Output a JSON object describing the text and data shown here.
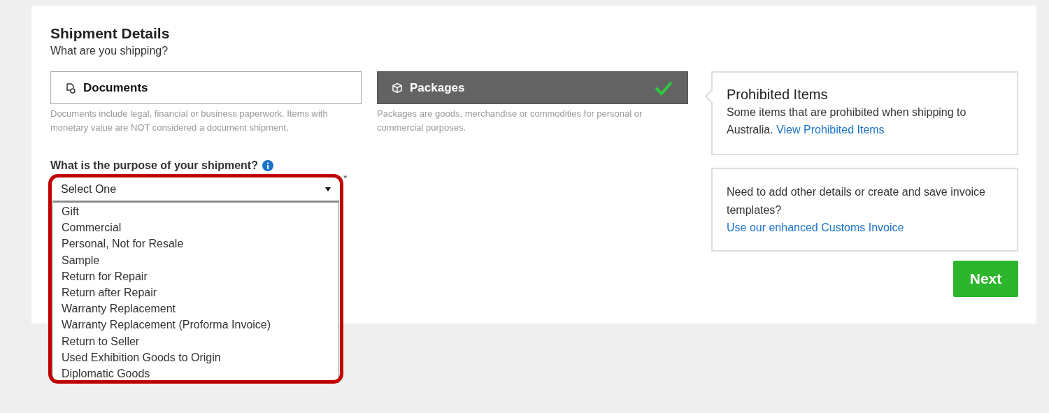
{
  "title": "Shipment Details",
  "subtitle": "What are you shipping?",
  "types": [
    {
      "kind": "documents",
      "label": "Documents",
      "description": "Documents include legal, financial or business paperwork. Items with monetary value are NOT considered a document shipment.",
      "selected": false
    },
    {
      "kind": "packages",
      "label": "Packages",
      "description": "Packages are goods, merchandise or commodities for personal or commercial purposes.",
      "selected": true
    }
  ],
  "purpose": {
    "label": "What is the purpose of your shipment?",
    "required": "*",
    "value": "Select One",
    "expanded": true,
    "options": [
      {
        "label": "Gift",
        "selected": false
      },
      {
        "label": "Commercial",
        "selected": false
      },
      {
        "label": "Personal, Not for Resale",
        "selected": false
      },
      {
        "label": "Sample",
        "selected": false
      },
      {
        "label": "Return for Repair",
        "selected": false
      },
      {
        "label": "Return after Repair",
        "selected": false
      },
      {
        "label": "Warranty Replacement",
        "selected": false
      },
      {
        "label": "Warranty Replacement (Proforma Invoice)",
        "selected": false
      },
      {
        "label": "Return to Seller",
        "selected": false
      },
      {
        "label": "Used Exhibition Goods to Origin",
        "selected": false
      },
      {
        "label": "Diplomatic Goods",
        "selected": false
      }
    ]
  },
  "prohibited": {
    "title": "Prohibited Items",
    "text": "Some items that are prohibited when shipping to Australia.",
    "link": "View Prohibited Items"
  },
  "invoice": {
    "text": "Need to add other details or create and save invoice templates?",
    "link": "Use our enhanced Customs Invoice"
  },
  "next_button": "Next"
}
